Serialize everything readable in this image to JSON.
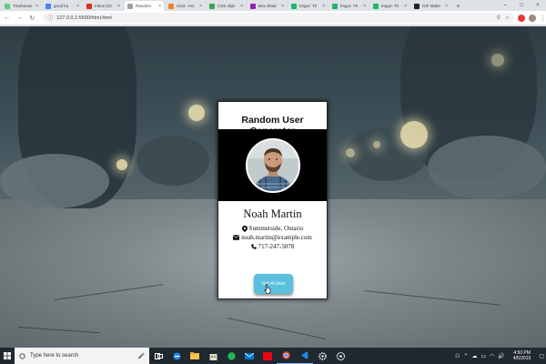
{
  "browser": {
    "tabs": [
      {
        "title": "Treehouse",
        "color": "#5fcf80",
        "active": false
      },
      {
        "title": "good bu",
        "color": "#4285f4",
        "active": false
      },
      {
        "title": "Inbox (22",
        "color": "#d93025",
        "active": false
      },
      {
        "title": "Random",
        "color": "#9aa0a6",
        "active": true
      },
      {
        "title": "css3 - Ho",
        "color": "#f48024",
        "active": false
      },
      {
        "title": "CSS obje",
        "color": "#34a853",
        "active": false
      },
      {
        "title": "Box Shad",
        "color": "#8e24aa",
        "active": false
      },
      {
        "title": "Imgur: Th",
        "color": "#1bb76e",
        "active": false
      },
      {
        "title": "Imgur: Th",
        "color": "#1bb76e",
        "active": false
      },
      {
        "title": "Imgur: Th",
        "color": "#1bb76e",
        "active": false
      },
      {
        "title": "GIF Make",
        "color": "#202124",
        "active": false
      }
    ],
    "tab_close": "×",
    "new_tab": "+",
    "window_controls": {
      "minimize": "–",
      "maximize": "□",
      "close": "×"
    },
    "nav": {
      "back": "←",
      "forward": "→",
      "reload": "↻"
    },
    "url": "127.0.0.1:5500/html.html",
    "info_icon": "ⓘ",
    "zoom_icon": "⚲",
    "star_icon": "☆",
    "menu": "⋮"
  },
  "card": {
    "title": "Random User Generator",
    "name": "Noah Martin",
    "location": "Summerside, Ontario",
    "email": "noah.martin@example.com",
    "phone": "717-247-5078",
    "button_label": "Get A User"
  },
  "taskbar": {
    "search_placeholder": "Type here to search",
    "mic": "🎤",
    "time": "4:50 PM",
    "date": "4/5/2019",
    "apps": [
      "edge",
      "file-explorer",
      "store",
      "spotify",
      "mail",
      "netflix",
      "chrome",
      "vscode",
      "settings",
      "music"
    ]
  },
  "colors": {
    "button": "#5bc0de",
    "photo_band": "#000000",
    "card_bg": "#ffffff"
  }
}
